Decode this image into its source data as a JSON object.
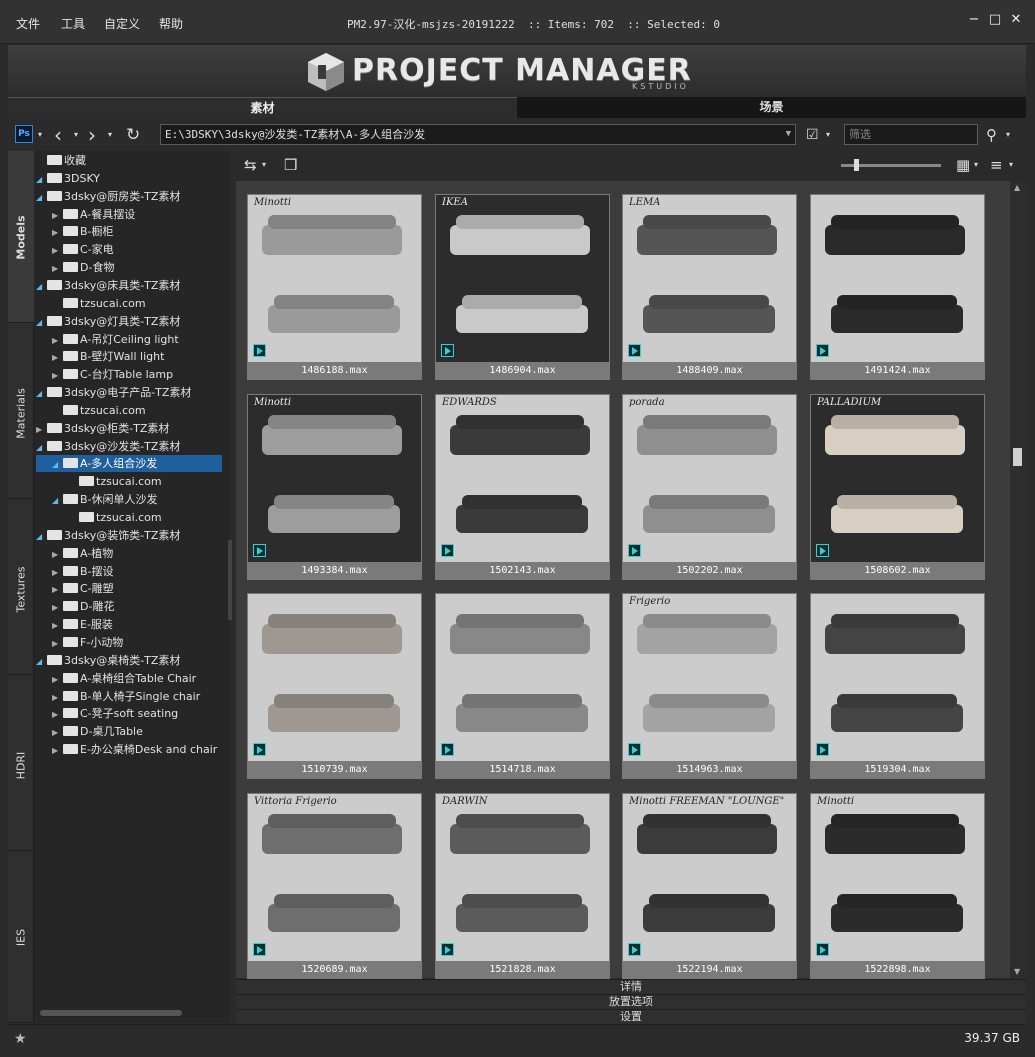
{
  "menu": [
    "文件",
    "工具",
    "自定义",
    "帮助"
  ],
  "title": "PM2.97-汉化-msjzs-20191222  :: Items: 702  :: Selected: 0",
  "window_buttons": {
    "minimize": "−",
    "maximize": "□",
    "close": "✕"
  },
  "logo": {
    "text": "PROJECT MANAGER",
    "sub": "KSTUDIO"
  },
  "tabs": [
    "素材",
    "场景"
  ],
  "toolbar": {
    "path": "E:\\3DSKY\\3dsky@沙发类-TZ素材\\A-多人组合沙发",
    "filter_placeholder": "筛选",
    "ps_label": "Ps"
  },
  "side_tabs": [
    "Models",
    "Materials",
    "Textures",
    "HDRI",
    "IES"
  ],
  "tree": [
    {
      "label": "收藏",
      "level": 0,
      "arrow": "",
      "icon": "star-folder"
    },
    {
      "label": "3DSKY",
      "level": 0,
      "arrow": "open"
    },
    {
      "label": "3dsky@厨房类-TZ素材",
      "level": 1,
      "arrow": "open"
    },
    {
      "label": "A-餐具摆设",
      "level": 2,
      "arrow": "closed"
    },
    {
      "label": "B-橱柜",
      "level": 2,
      "arrow": "closed"
    },
    {
      "label": "C-家电",
      "level": 2,
      "arrow": "closed"
    },
    {
      "label": "D-食物",
      "level": 2,
      "arrow": "closed"
    },
    {
      "label": "3dsky@床具类-TZ素材",
      "level": 1,
      "arrow": "open"
    },
    {
      "label": "tzsucai.com",
      "level": 2,
      "arrow": ""
    },
    {
      "label": "3dsky@灯具类-TZ素材",
      "level": 1,
      "arrow": "open"
    },
    {
      "label": "A-吊灯Ceiling light",
      "level": 2,
      "arrow": "closed"
    },
    {
      "label": "B-壁灯Wall light",
      "level": 2,
      "arrow": "closed"
    },
    {
      "label": "C-台灯Table lamp",
      "level": 2,
      "arrow": "closed"
    },
    {
      "label": "3dsky@电子产品-TZ素材",
      "level": 1,
      "arrow": "open"
    },
    {
      "label": "tzsucai.com",
      "level": 2,
      "arrow": ""
    },
    {
      "label": "3dsky@柜类-TZ素材",
      "level": 1,
      "arrow": "closed"
    },
    {
      "label": "3dsky@沙发类-TZ素材",
      "level": 1,
      "arrow": "open"
    },
    {
      "label": "A-多人组合沙发",
      "level": 2,
      "arrow": "open",
      "selected": true
    },
    {
      "label": "tzsucai.com",
      "level": 3,
      "arrow": ""
    },
    {
      "label": "B-休闲单人沙发",
      "level": 2,
      "arrow": "open"
    },
    {
      "label": "tzsucai.com",
      "level": 3,
      "arrow": ""
    },
    {
      "label": "3dsky@装饰类-TZ素材",
      "level": 1,
      "arrow": "open"
    },
    {
      "label": "A-植物",
      "level": 2,
      "arrow": "closed"
    },
    {
      "label": "B-摆设",
      "level": 2,
      "arrow": "closed"
    },
    {
      "label": "C-雕塑",
      "level": 2,
      "arrow": "closed"
    },
    {
      "label": "D-雕花",
      "level": 2,
      "arrow": "closed"
    },
    {
      "label": "E-服装",
      "level": 2,
      "arrow": "closed"
    },
    {
      "label": "F-小动物",
      "level": 2,
      "arrow": "closed"
    },
    {
      "label": "3dsky@桌椅类-TZ素材",
      "level": 1,
      "arrow": "open"
    },
    {
      "label": "A-桌椅组合Table Chair",
      "level": 2,
      "arrow": "closed"
    },
    {
      "label": "B-单人椅子Single chair",
      "level": 2,
      "arrow": "closed"
    },
    {
      "label": "C-凳子soft seating",
      "level": 2,
      "arrow": "closed"
    },
    {
      "label": "D-桌几Table",
      "level": 2,
      "arrow": "closed"
    },
    {
      "label": "E-办公桌椅Desk and chair",
      "level": 2,
      "arrow": "closed"
    }
  ],
  "items": [
    {
      "file": "1486188.max",
      "brand": "Minotti",
      "dark": false,
      "sofa": "#9a9a9a"
    },
    {
      "file": "1486904.max",
      "brand": "IKEA",
      "dark": true,
      "sofa": "#c9c9c9"
    },
    {
      "file": "1488409.max",
      "brand": "LEMA",
      "dark": false,
      "sofa": "#555555"
    },
    {
      "file": "1491424.max",
      "brand": "",
      "dark": false,
      "sofa": "#2a2a2a"
    },
    {
      "file": "1493384.max",
      "brand": "Minotti",
      "dark": true,
      "sofa": "#9d9d9d"
    },
    {
      "file": "1502143.max",
      "brand": "EDWARDS",
      "dark": false,
      "sofa": "#3a3a3a"
    },
    {
      "file": "1502202.max",
      "brand": "porada",
      "dark": false,
      "sofa": "#8f8f8f"
    },
    {
      "file": "1508602.max",
      "brand": "PALLADIUM",
      "dark": true,
      "sofa": "#d8cfc2"
    },
    {
      "file": "1510739.max",
      "brand": "",
      "dark": false,
      "sofa": "#9e9890"
    },
    {
      "file": "1514718.max",
      "brand": "",
      "dark": false,
      "sofa": "#888888"
    },
    {
      "file": "1514963.max",
      "brand": "Frigerio",
      "dark": false,
      "sofa": "#a3a3a3"
    },
    {
      "file": "1519304.max",
      "brand": "",
      "dark": false,
      "sofa": "#444444"
    },
    {
      "file": "1520689.max",
      "brand": "Vittoria Frigerio",
      "dark": false,
      "sofa": "#6e6e6e"
    },
    {
      "file": "1521828.max",
      "brand": "DARWIN",
      "dark": false,
      "sofa": "#5b5b5b"
    },
    {
      "file": "1522194.max",
      "brand": "Minotti FREEMAN \"LOUNGE\"",
      "dark": false,
      "sofa": "#3b3b3b"
    },
    {
      "file": "1522898.max",
      "brand": "Minotti",
      "dark": false,
      "sofa": "#2b2b2b"
    }
  ],
  "panels": [
    "详情",
    "放置选项",
    "设置"
  ],
  "status": {
    "disk": "39.37 GB"
  },
  "zoom_slider": 0.13
}
